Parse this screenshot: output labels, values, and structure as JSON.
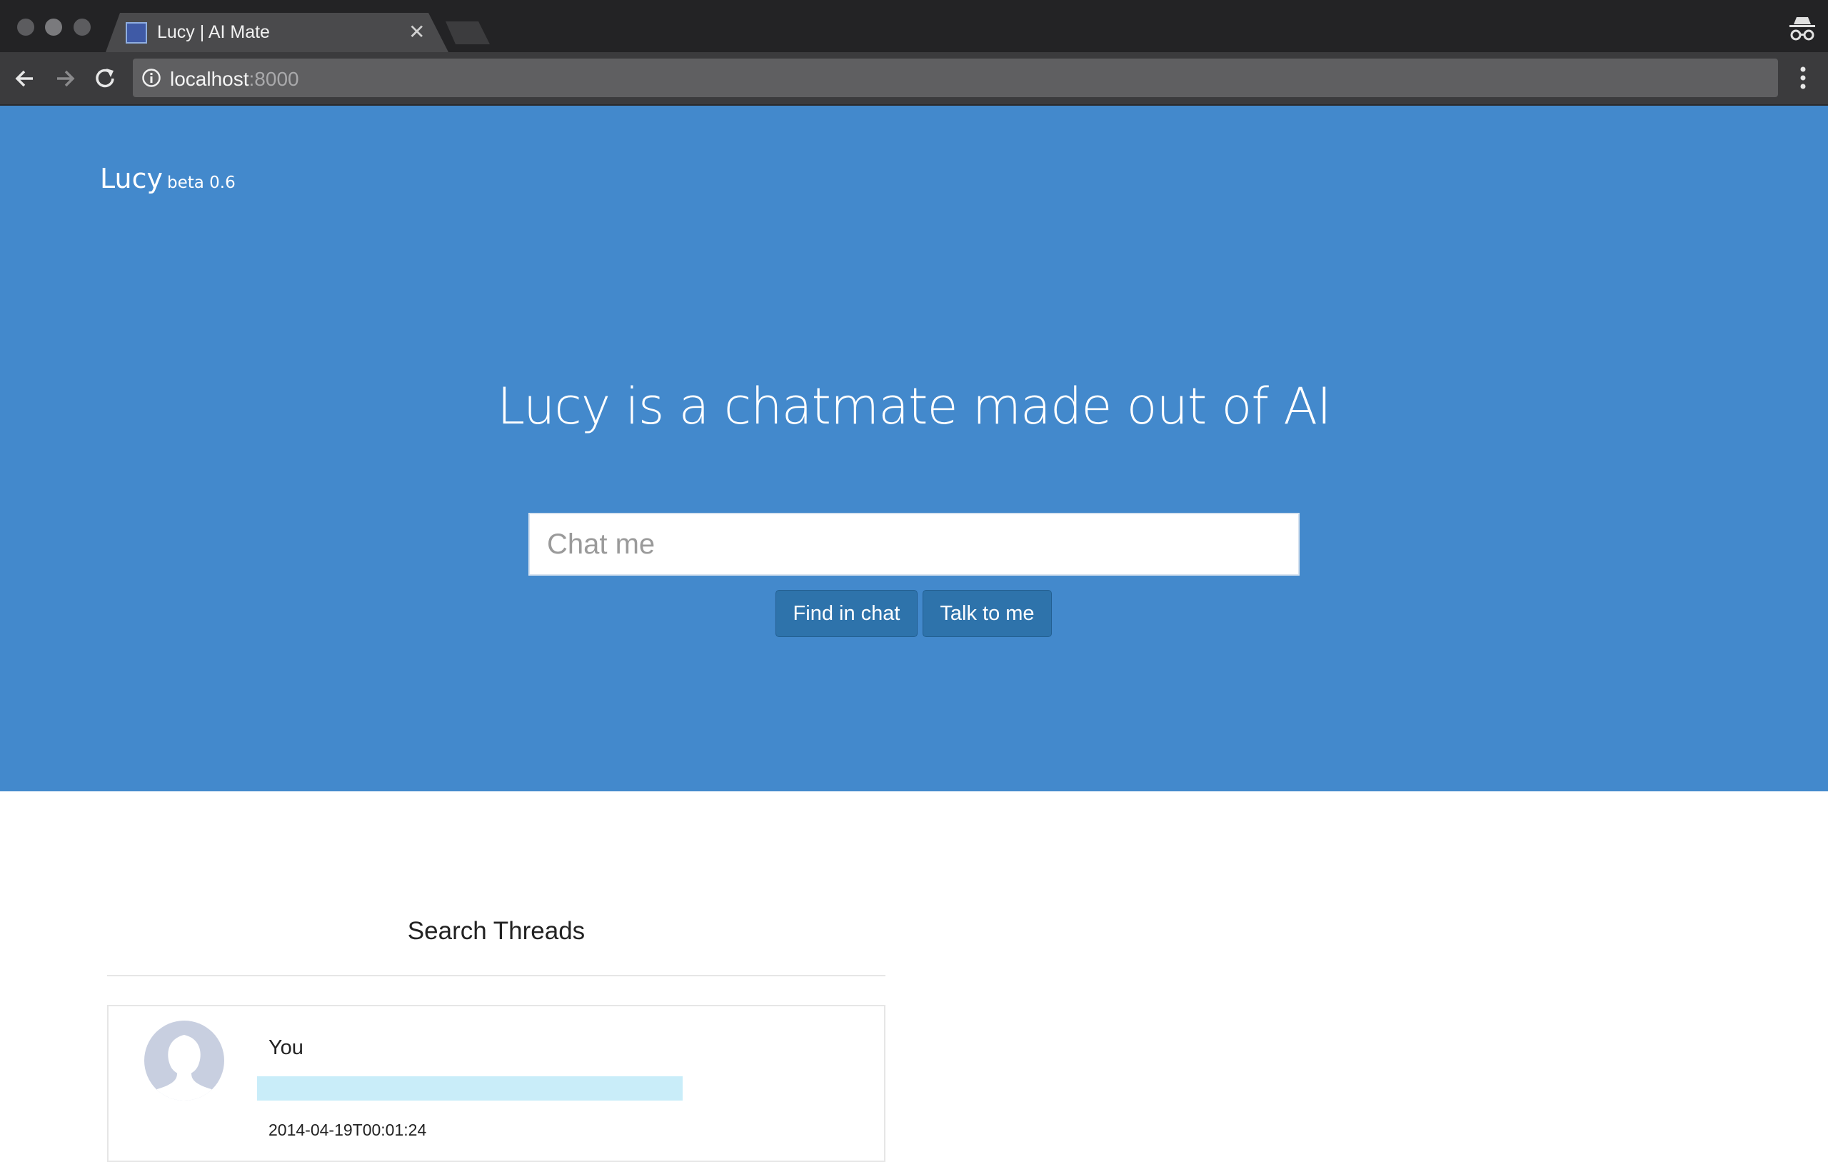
{
  "browser": {
    "tab": {
      "title": "Lucy | AI Mate"
    },
    "address": {
      "host": "localhost",
      "port": ":8000"
    }
  },
  "page": {
    "brand": {
      "name": "Lucy",
      "version": "beta 0.6"
    },
    "hero": {
      "headline": "Lucy is a chatmate made out of AI",
      "input_placeholder": "Chat me",
      "find_button": "Find in chat",
      "talk_button": "Talk to me"
    },
    "threads": {
      "title": "Search Threads",
      "items": [
        {
          "author": "You",
          "timestamp": "2014-04-19T00:01:24"
        }
      ]
    }
  },
  "colors": {
    "hero_background": "#4389cc",
    "button": "#2e73ab",
    "message_highlight": "#c9edf9"
  }
}
